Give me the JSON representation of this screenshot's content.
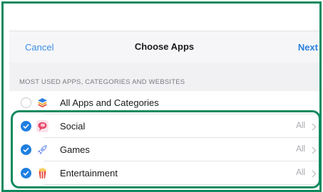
{
  "navbar": {
    "cancel_label": "Cancel",
    "title": "Choose Apps",
    "next_label": "Next"
  },
  "section_header": "MOST USED APPS, CATEGORIES AND WEBSITES",
  "rows": [
    {
      "label": "All Apps and Categories",
      "value": "",
      "checked": false,
      "icon": "stack-icon"
    },
    {
      "label": "Social",
      "value": "All",
      "checked": true,
      "icon": "chat-bubble-icon"
    },
    {
      "label": "Games",
      "value": "All",
      "checked": true,
      "icon": "rocket-icon"
    },
    {
      "label": "Entertainment",
      "value": "All",
      "checked": true,
      "icon": "popcorn-icon"
    }
  ],
  "colors": {
    "accent": "#2a7fde",
    "highlight_border": "#0f8a5f",
    "checked": "#1f7fe0"
  }
}
